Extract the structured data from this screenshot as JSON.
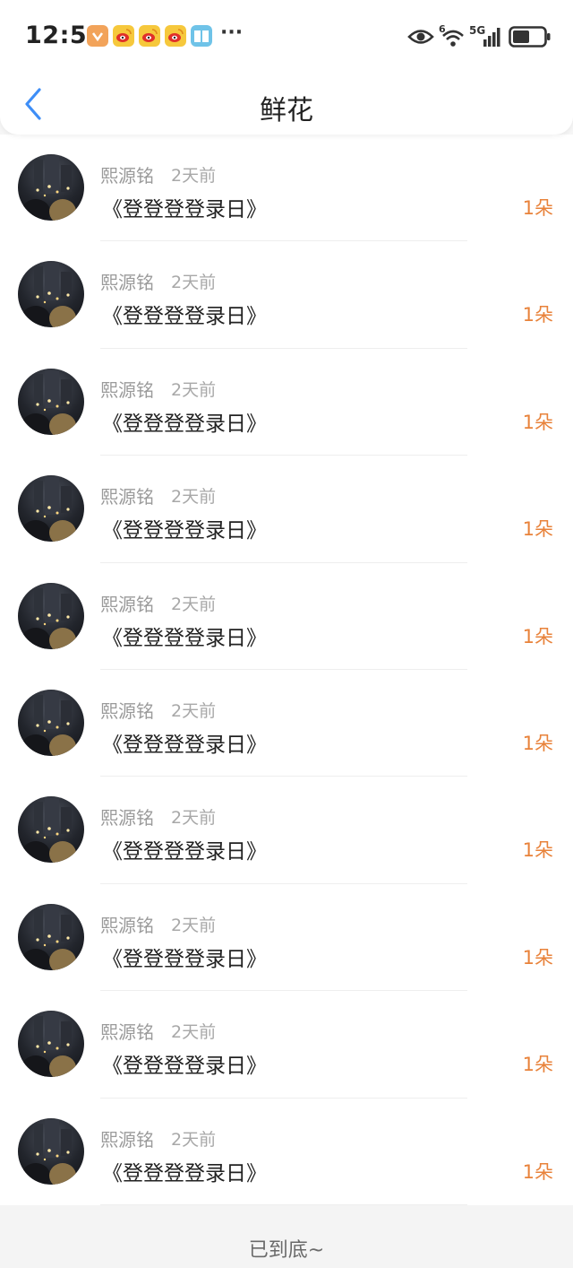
{
  "status_bar": {
    "time": "12:53",
    "more": "···",
    "network_6": "6",
    "network_5g": "5G",
    "app_icons": [
      "shield-app-icon",
      "weibo-icon",
      "weibo-icon",
      "weibo-icon",
      "reader-app-icon"
    ],
    "battery_level": 0.55
  },
  "nav": {
    "title": "鲜花",
    "back_icon": "chevron-left-icon",
    "accent_color": "#3e8ef7"
  },
  "list": {
    "items": [
      {
        "name": "熙源铭",
        "ago": "2天前",
        "subject": "《登登登登录日》",
        "count": "1朵"
      },
      {
        "name": "熙源铭",
        "ago": "2天前",
        "subject": "《登登登登录日》",
        "count": "1朵"
      },
      {
        "name": "熙源铭",
        "ago": "2天前",
        "subject": "《登登登登录日》",
        "count": "1朵"
      },
      {
        "name": "熙源铭",
        "ago": "2天前",
        "subject": "《登登登登录日》",
        "count": "1朵"
      },
      {
        "name": "熙源铭",
        "ago": "2天前",
        "subject": "《登登登登录日》",
        "count": "1朵"
      },
      {
        "name": "熙源铭",
        "ago": "2天前",
        "subject": "《登登登登录日》",
        "count": "1朵"
      },
      {
        "name": "熙源铭",
        "ago": "2天前",
        "subject": "《登登登登录日》",
        "count": "1朵"
      },
      {
        "name": "熙源铭",
        "ago": "2天前",
        "subject": "《登登登登录日》",
        "count": "1朵"
      },
      {
        "name": "熙源铭",
        "ago": "2天前",
        "subject": "《登登登登录日》",
        "count": "1朵"
      },
      {
        "name": "熙源铭",
        "ago": "2天前",
        "subject": "《登登登登录日》",
        "count": "1朵"
      }
    ],
    "count_color": "#e8823a"
  },
  "footer": {
    "text": "已到底~"
  }
}
